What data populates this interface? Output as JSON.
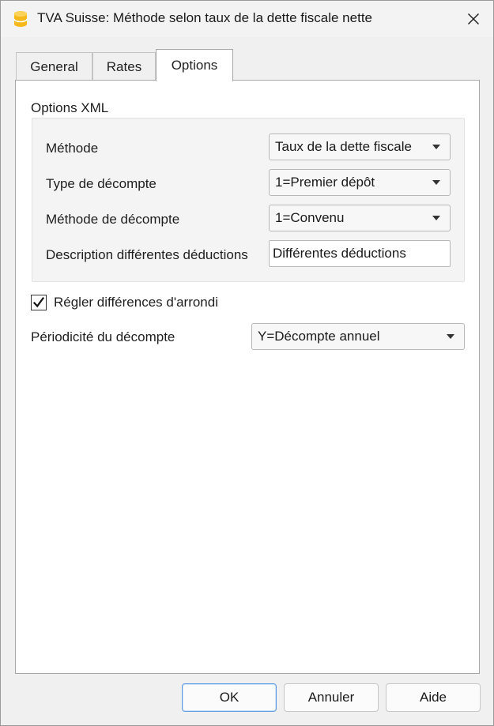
{
  "window": {
    "title": "TVA Suisse: Méthode selon taux de la dette fiscale nette",
    "app_icon": "banana-database-icon",
    "close_icon": "close-icon"
  },
  "tabs": [
    {
      "label": "General",
      "active": false
    },
    {
      "label": "Rates",
      "active": false
    },
    {
      "label": "Options",
      "active": true
    }
  ],
  "options": {
    "xml_group_title": "Options XML",
    "fields": {
      "methode": {
        "label": "Méthode",
        "value": "Taux de la dette fiscale"
      },
      "type_decompte": {
        "label": "Type de décompte",
        "value": "1=Premier dépôt"
      },
      "methode_decompte": {
        "label": "Méthode de décompte",
        "value": "1=Convenu"
      },
      "description": {
        "label": "Description différentes déductions",
        "value": "Différentes déductions"
      }
    },
    "rounding_checkbox": {
      "label": "Régler différences d'arrondi",
      "checked": true
    },
    "periodicite": {
      "label": "Périodicité du décompte",
      "value": "Y=Décompte annuel"
    }
  },
  "buttons": {
    "ok": "OK",
    "cancel": "Annuler",
    "help": "Aide"
  },
  "colors": {
    "icon_yellow": "#f6b81a",
    "default_button_border": "#5d9be0"
  }
}
